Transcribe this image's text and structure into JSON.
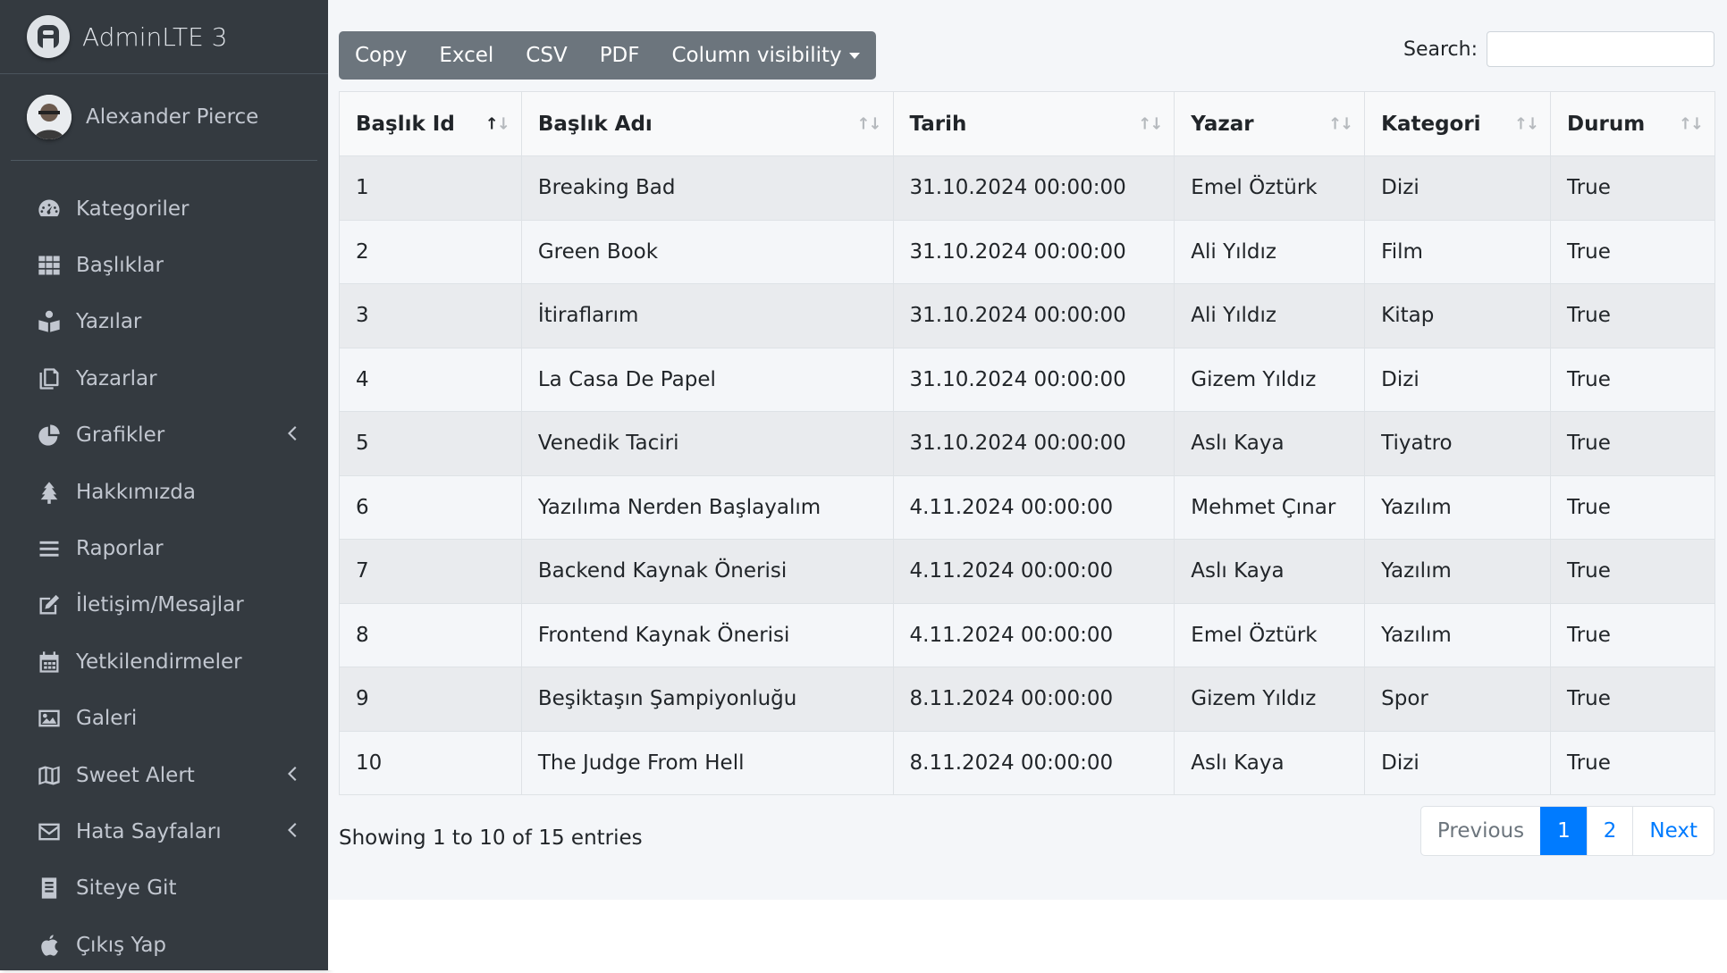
{
  "brand": {
    "title": "AdminLTE 3"
  },
  "user": {
    "name": "Alexander Pierce"
  },
  "sidebar": {
    "items": [
      {
        "label": "Kategoriler",
        "icon": "tachometer-icon",
        "submenu": false
      },
      {
        "label": "Başlıklar",
        "icon": "grid-icon",
        "submenu": false
      },
      {
        "label": "Yazılar",
        "icon": "book-reader-icon",
        "submenu": false
      },
      {
        "label": "Yazarlar",
        "icon": "copy-icon",
        "submenu": false
      },
      {
        "label": "Grafikler",
        "icon": "pie-chart-icon",
        "submenu": true
      },
      {
        "label": "Hakkımızda",
        "icon": "tree-icon",
        "submenu": false
      },
      {
        "label": "Raporlar",
        "icon": "bars-icon",
        "submenu": false
      },
      {
        "label": "İletişim/Mesajlar",
        "icon": "edit-icon",
        "submenu": false
      },
      {
        "label": "Yetkilendirmeler",
        "icon": "calendar-icon",
        "submenu": false
      },
      {
        "label": "Galeri",
        "icon": "image-icon",
        "submenu": false
      },
      {
        "label": "Sweet Alert",
        "icon": "map-icon",
        "submenu": true
      },
      {
        "label": "Hata Sayfaları",
        "icon": "envelope-icon",
        "submenu": true
      },
      {
        "label": "Siteye Git",
        "icon": "book-icon",
        "submenu": false
      },
      {
        "label": "Çıkış Yap",
        "icon": "apple-icon",
        "submenu": false
      }
    ]
  },
  "toolbar": {
    "copy_label": "Copy",
    "excel_label": "Excel",
    "csv_label": "CSV",
    "pdf_label": "PDF",
    "colvis_label": "Column visibility"
  },
  "search": {
    "label": "Search:",
    "value": ""
  },
  "table": {
    "columns": [
      "Başlık Id",
      "Başlık Adı",
      "Tarih",
      "Yazar",
      "Kategori",
      "Durum"
    ],
    "rows": [
      [
        "1",
        "Breaking Bad",
        "31.10.2024 00:00:00",
        "Emel Öztürk",
        "Dizi",
        "True"
      ],
      [
        "2",
        "Green Book",
        "31.10.2024 00:00:00",
        "Ali Yıldız",
        "Film",
        "True"
      ],
      [
        "3",
        "İtiraflarım",
        "31.10.2024 00:00:00",
        "Ali Yıldız",
        "Kitap",
        "True"
      ],
      [
        "4",
        "La Casa De Papel",
        "31.10.2024 00:00:00",
        "Gizem Yıldız",
        "Dizi",
        "True"
      ],
      [
        "5",
        "Venedik Taciri",
        "31.10.2024 00:00:00",
        "Aslı Kaya",
        "Tiyatro",
        "True"
      ],
      [
        "6",
        "Yazılıma Nerden Başlayalım",
        "4.11.2024 00:00:00",
        "Mehmet Çınar",
        "Yazılım",
        "True"
      ],
      [
        "7",
        "Backend Kaynak Önerisi",
        "4.11.2024 00:00:00",
        "Aslı Kaya",
        "Yazılım",
        "True"
      ],
      [
        "8",
        "Frontend Kaynak Önerisi",
        "4.11.2024 00:00:00",
        "Emel Öztürk",
        "Yazılım",
        "True"
      ],
      [
        "9",
        "Beşiktaşın Şampiyonluğu",
        "8.11.2024 00:00:00",
        "Gizem Yıldız",
        "Spor",
        "True"
      ],
      [
        "10",
        "The Judge From Hell",
        "8.11.2024 00:00:00",
        "Aslı Kaya",
        "Dizi",
        "True"
      ]
    ]
  },
  "footer": {
    "info": "Showing 1 to 10 of 15 entries",
    "previous": "Previous",
    "pages": [
      "1",
      "2"
    ],
    "next": "Next",
    "active_page": "1"
  },
  "colors": {
    "sidebar_bg": "#343a40",
    "content_bg": "#f4f6f9",
    "primary": "#007bff",
    "button_bg": "#6c757d"
  }
}
